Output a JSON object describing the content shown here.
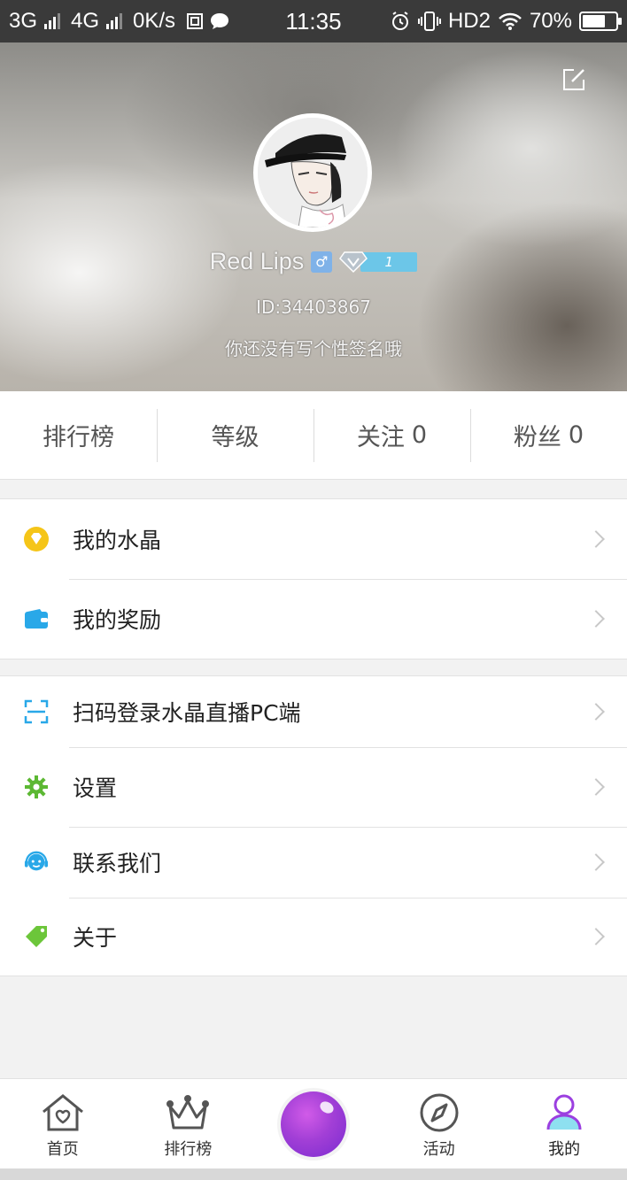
{
  "status_bar": {
    "net1": "3G",
    "net2": "4G",
    "speed": "0K/s",
    "time": "11:35",
    "hd": "HD2",
    "battery": "70%",
    "battery_level": 0.7
  },
  "profile": {
    "name": "Red Lips",
    "gender_symbol": "♂",
    "vip_level": "1",
    "user_id": "ID:34403867",
    "signature": "你还没有写个性签名哦"
  },
  "stats": [
    {
      "label": "排行榜",
      "count": ""
    },
    {
      "label": "等级",
      "count": ""
    },
    {
      "label": "关注",
      "count": "0"
    },
    {
      "label": "粉丝",
      "count": "0"
    }
  ],
  "menu_group1": [
    {
      "label": "我的水晶",
      "icon": "crystal-icon",
      "color": "#f5c518"
    },
    {
      "label": "我的奖励",
      "icon": "wallet-icon",
      "color": "#29a8e8"
    }
  ],
  "menu_group2": [
    {
      "label": "扫码登录水晶直播PC端",
      "icon": "scan-icon",
      "color": "#29a8e8"
    },
    {
      "label": "设置",
      "icon": "gear-icon",
      "color": "#5cb833"
    },
    {
      "label": "联系我们",
      "icon": "customer-service-icon",
      "color": "#29a8e8"
    },
    {
      "label": "关于",
      "icon": "tag-icon",
      "color": "#6cc63a"
    }
  ],
  "bottom_nav": [
    {
      "label": "首页",
      "icon": "home-icon"
    },
    {
      "label": "排行榜",
      "icon": "crown-icon"
    },
    {
      "label": "",
      "icon": "live-orb-icon"
    },
    {
      "label": "活动",
      "icon": "compass-icon"
    },
    {
      "label": "我的",
      "icon": "user-icon",
      "active": true
    }
  ]
}
